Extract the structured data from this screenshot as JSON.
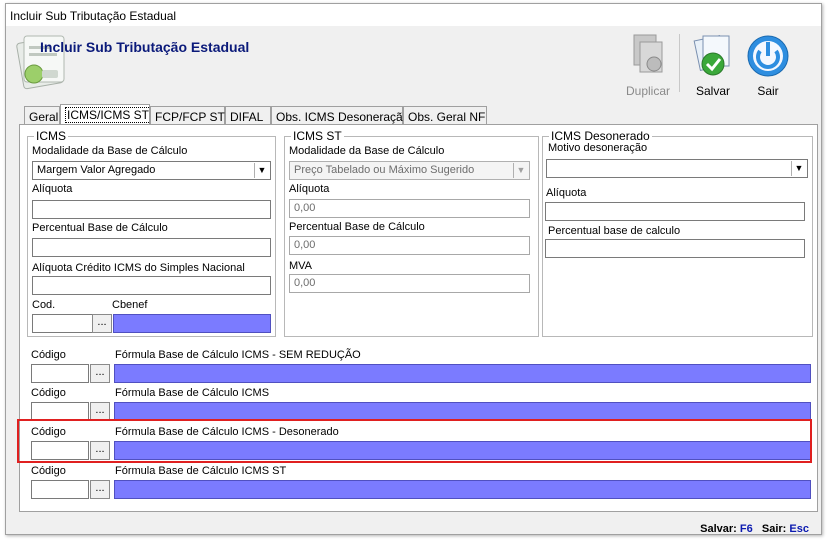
{
  "window": {
    "title": "Incluir Sub Tributação Estadual"
  },
  "header": {
    "title": "Incluir Sub Tributação Estadual"
  },
  "toolbar": {
    "duplicar": "Duplicar",
    "salvar": "Salvar",
    "sair": "Sair"
  },
  "tabs": [
    {
      "label": "Geral"
    },
    {
      "label": "ICMS/ICMS ST"
    },
    {
      "label": "FCP/FCP ST"
    },
    {
      "label": "DIFAL"
    },
    {
      "label": "Obs. ICMS Desoneração"
    },
    {
      "label": "Obs. Geral NF"
    }
  ],
  "icms": {
    "group_title": "ICMS",
    "modalidade_label": "Modalidade da Base de Cálculo",
    "modalidade_value": "Margem Valor Agregado",
    "aliquota_label": "Alíquota",
    "perc_base_label": "Percentual Base de Cálculo",
    "aliq_credito_label": "Alíquota Crédito ICMS do Simples Nacional",
    "cod_label": "Cod.",
    "cbenef_label": "Cbenef",
    "dots": "..."
  },
  "icms_st": {
    "group_title": "ICMS ST",
    "modalidade_label": "Modalidade da Base de Cálculo",
    "modalidade_value": "Preço Tabelado ou Máximo Sugerido",
    "aliquota_label": "Alíquota",
    "aliquota_value": "0,00",
    "perc_base_label": "Percentual Base de Cálculo",
    "perc_base_value": "0,00",
    "mva_label": "MVA",
    "mva_value": "0,00"
  },
  "icms_deson": {
    "group_title": "ICMS Desonerado",
    "motivo_label": "Motivo desoneração",
    "aliquota_label": "Alíquota",
    "perc_base_label": "Percentual base de calculo"
  },
  "formulas": [
    {
      "codigo_label": "Código",
      "label": "Fórmula Base de Cálculo ICMS - SEM REDUÇÃO",
      "dots": "..."
    },
    {
      "codigo_label": "Código",
      "label": "Fórmula Base de Cálculo ICMS",
      "dots": "..."
    },
    {
      "codigo_label": "Código",
      "label": "Fórmula Base de Cálculo ICMS - Desonerado",
      "dots": "..."
    },
    {
      "codigo_label": "Código",
      "label": "Fórmula Base de Cálculo ICMS ST",
      "dots": "..."
    }
  ],
  "status": {
    "salvar_label": "Salvar:",
    "salvar_key": "F6",
    "sair_label": "Sair:",
    "sair_key": "Esc"
  },
  "colors": {
    "formula_field": "#7b7bff",
    "highlight": "#e02020",
    "title": "#0b1a7a"
  }
}
